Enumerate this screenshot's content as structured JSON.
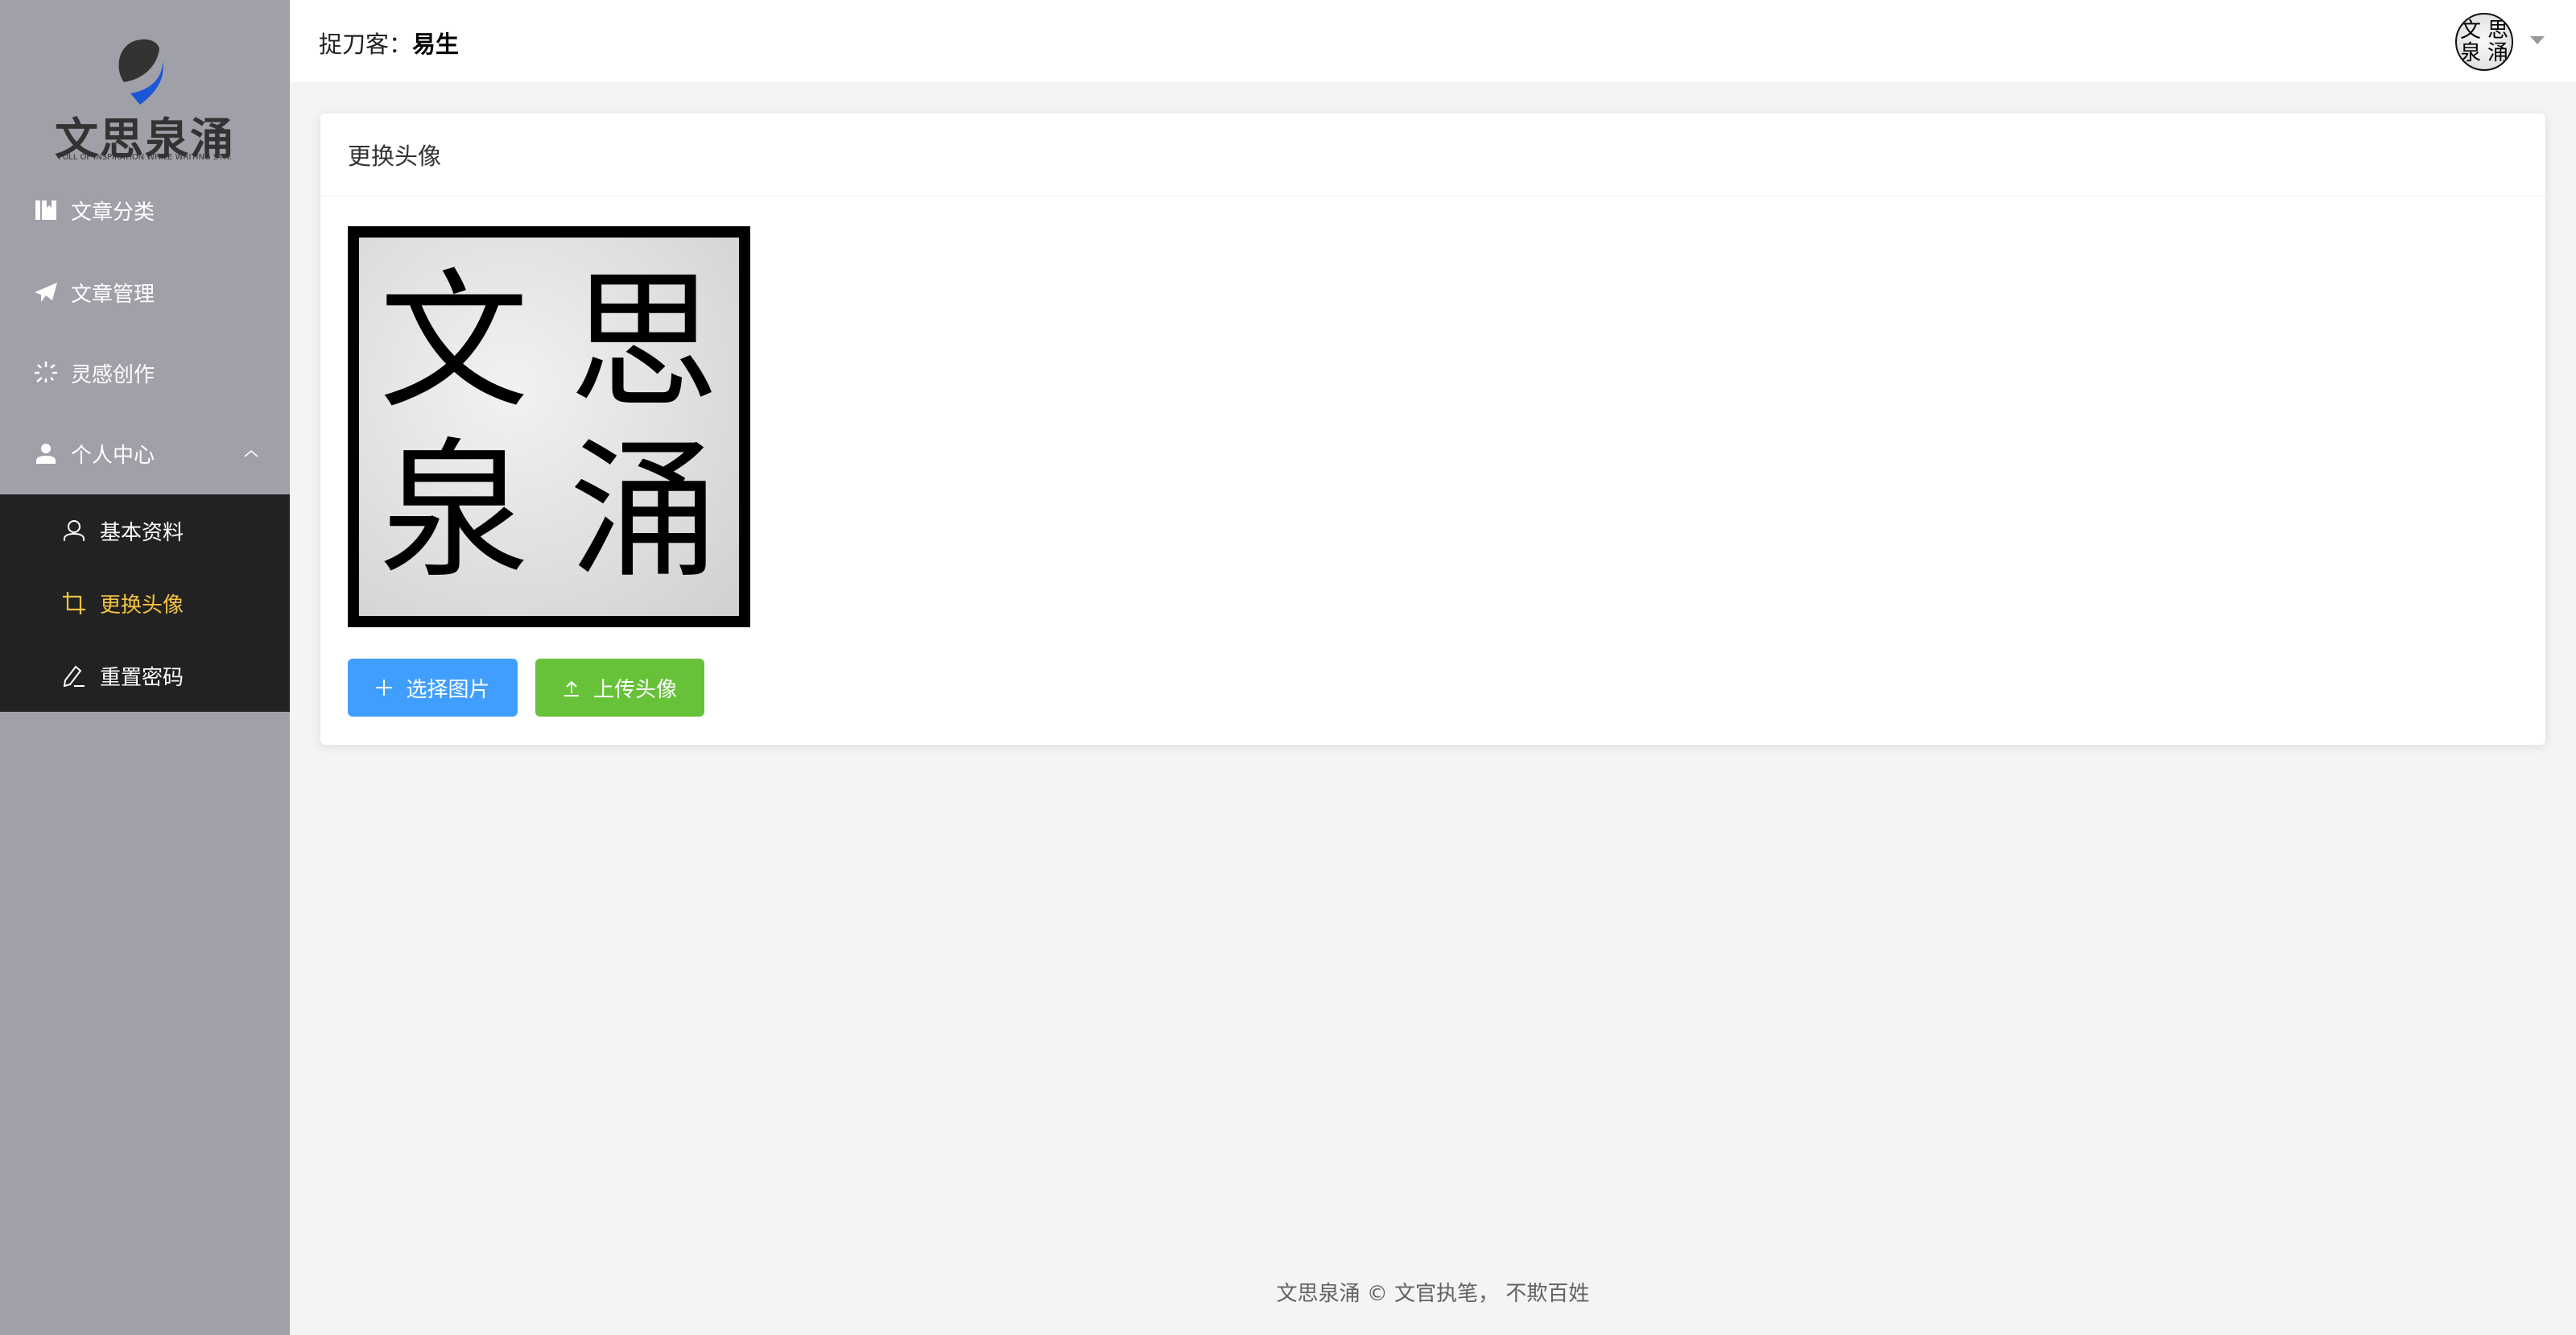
{
  "brand": {
    "name": "文思泉涌",
    "tagline": "FULL OF INSPIRATION WHILE WRITING STH.",
    "accent": "#1a56d6"
  },
  "sidebar": {
    "items": [
      {
        "label": "文章分类",
        "icon": "book-icon"
      },
      {
        "label": "文章管理",
        "icon": "send-icon"
      },
      {
        "label": "灵感创作",
        "icon": "loading-icon"
      },
      {
        "label": "个人中心",
        "icon": "user-icon",
        "expanded": true
      }
    ],
    "submenu": [
      {
        "label": "基本资料",
        "icon": "user-outline-icon"
      },
      {
        "label": "更换头像",
        "icon": "crop-icon",
        "active": true
      },
      {
        "label": "重置密码",
        "icon": "edit-pen-icon"
      }
    ]
  },
  "header": {
    "greeting_prefix": "捉刀客：",
    "username": "易生",
    "avatar_chars": [
      "文",
      "思",
      "泉",
      "涌"
    ]
  },
  "card": {
    "title": "更换头像",
    "preview_chars": [
      "文",
      "思",
      "泉",
      "涌"
    ],
    "select_button": "选择图片",
    "upload_button": "上传头像"
  },
  "colors": {
    "active": "#f5c342",
    "primary": "#409eff",
    "success": "#67c23a"
  },
  "footer": {
    "text": "文思泉涌 © 文官执笔， 不欺百姓"
  }
}
